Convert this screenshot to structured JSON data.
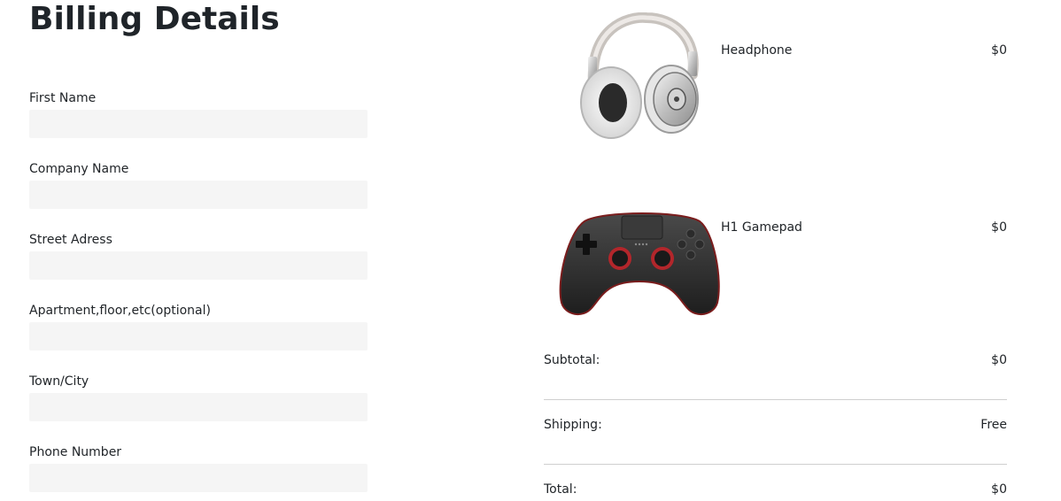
{
  "billing": {
    "title": "Billing Details",
    "fields": [
      {
        "label": "First Name",
        "value": ""
      },
      {
        "label": "Company Name",
        "value": ""
      },
      {
        "label": "Street Adress",
        "value": ""
      },
      {
        "label": "Apartment,floor,etc(optional)",
        "value": ""
      },
      {
        "label": "Town/City",
        "value": ""
      },
      {
        "label": "Phone Number",
        "value": ""
      }
    ]
  },
  "order": {
    "items": [
      {
        "name": "Headphone",
        "price": "$0",
        "icon": "headphone-icon"
      },
      {
        "name": "H1 Gamepad",
        "price": "$0",
        "icon": "gamepad-icon"
      }
    ],
    "subtotal_label": "Subtotal:",
    "subtotal_value": "$0",
    "shipping_label": "Shipping:",
    "shipping_value": "Free",
    "total_label": "Total:",
    "total_value": "$0"
  }
}
